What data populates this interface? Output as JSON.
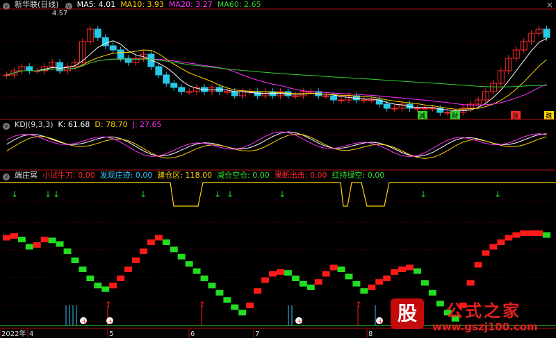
{
  "main_panel": {
    "title": "新华联(日线)",
    "ma5": "MA5: 4.01",
    "ma10": "MA10: 3.93",
    "ma20": "MA20: 3.27",
    "ma60": "MA60: 2.65",
    "high_label": "4.57",
    "signals": [
      "减",
      "财",
      "涨",
      "魏"
    ]
  },
  "kdj_panel": {
    "title": "KDJ(9,3,3)",
    "k": "K: 61.68",
    "d": "D: 78.70",
    "j": "J: 27.65"
  },
  "zhuang_panel": {
    "title": "端庄冥",
    "items": [
      {
        "text": "小试牛刀: 0.00",
        "color": "#ff2a2a"
      },
      {
        "text": "发现庄迹: 0.00",
        "color": "#2ec9ff"
      },
      {
        "text": "建仓区: 118.00",
        "color": "#ffd400"
      },
      {
        "text": "减仓空仓: 0.00",
        "color": "#30e030"
      },
      {
        "text": "果断出击: 0.00",
        "color": "#ff2a2a"
      },
      {
        "text": "红持绿空: 0.00",
        "color": "#30e030"
      }
    ]
  },
  "x_axis": [
    "2022年",
    "4",
    "5",
    "6",
    "7",
    "8"
  ],
  "watermark": {
    "icon": "股",
    "title": "公式之家",
    "url": "www.gszj100.com"
  },
  "colors": {
    "up": "#ff2a2a",
    "down": "#26c9e8",
    "ma5": "#ffffff",
    "ma10": "#ffd400",
    "ma20": "#ff30ff",
    "ma60": "#30d030",
    "red": "#ff1a1a",
    "green": "#22dd22"
  },
  "chart_data": {
    "type": "line",
    "close_prices": [
      3.2,
      3.3,
      3.4,
      3.3,
      3.3,
      3.4,
      3.5,
      3.3,
      3.4,
      3.5,
      4.0,
      4.3,
      4.1,
      3.9,
      3.8,
      3.6,
      3.5,
      3.6,
      3.7,
      3.4,
      3.2,
      3.0,
      2.9,
      2.8,
      2.8,
      2.9,
      2.8,
      2.9,
      2.8,
      2.8,
      2.7,
      2.8,
      2.8,
      2.7,
      2.8,
      2.7,
      2.8,
      2.7,
      2.7,
      2.8,
      2.8,
      2.7,
      2.7,
      2.6,
      2.6,
      2.7,
      2.6,
      2.6,
      2.6,
      2.5,
      2.4,
      2.4,
      2.5,
      2.4,
      2.4,
      2.4,
      2.4,
      2.3,
      2.3,
      2.3,
      2.4,
      2.5,
      2.6,
      2.8,
      3.0,
      3.3,
      3.6,
      3.8,
      4.0,
      4.2,
      4.3,
      4.1
    ],
    "step_values": [
      0.95,
      0.97,
      0.93,
      0.85,
      0.87,
      0.93,
      0.92,
      0.88,
      0.8,
      0.7,
      0.6,
      0.5,
      0.42,
      0.38,
      0.42,
      0.5,
      0.6,
      0.7,
      0.8,
      0.9,
      0.95,
      0.9,
      0.82,
      0.74,
      0.66,
      0.58,
      0.5,
      0.42,
      0.34,
      0.26,
      0.18,
      0.12,
      0.2,
      0.36,
      0.48,
      0.55,
      0.57,
      0.56,
      0.5,
      0.44,
      0.4,
      0.46,
      0.55,
      0.62,
      0.6,
      0.52,
      0.44,
      0.36,
      0.4,
      0.46,
      0.5,
      0.57,
      0.6,
      0.62,
      0.58,
      0.45,
      0.34,
      0.22,
      0.12,
      0.05,
      0.2,
      0.45,
      0.65,
      0.78,
      0.85,
      0.9,
      0.95,
      0.98,
      1.0,
      1.0,
      1.0,
      0.98
    ]
  }
}
